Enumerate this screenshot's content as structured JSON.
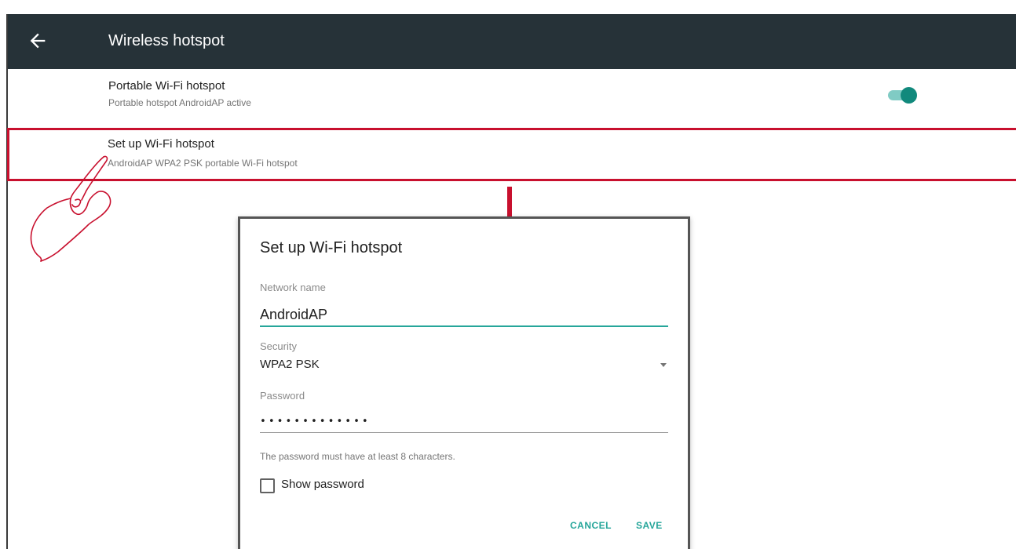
{
  "appbar": {
    "back_icon": "arrow-back-icon",
    "title": "Wireless hotspot",
    "background": "#263238"
  },
  "settings": {
    "portable": {
      "title": "Portable Wi-Fi hotspot",
      "subtitle": "Portable hotspot AndroidAP active",
      "toggle_on": true
    },
    "setup": {
      "title": "Set up Wi-Fi hotspot",
      "subtitle": "AndroidAP WPA2 PSK portable Wi-Fi hotspot"
    }
  },
  "annotations": {
    "highlight_color": "#c8102e",
    "pointer_icon": "hand-pointer-icon",
    "arrow_icon": "arrow-down-icon"
  },
  "dialog": {
    "title": "Set up Wi-Fi hotspot",
    "network_name_label": "Network name",
    "network_name_value": "AndroidAP",
    "security_label": "Security",
    "security_value": "WPA2 PSK",
    "password_label": "Password",
    "password_value": "•••••••••••••",
    "password_hint": "The password must have at least 8 characters.",
    "show_password_label": "Show password",
    "show_password_checked": false,
    "cancel_label": "CANCEL",
    "save_label": "SAVE",
    "accent": "#26a69a"
  }
}
